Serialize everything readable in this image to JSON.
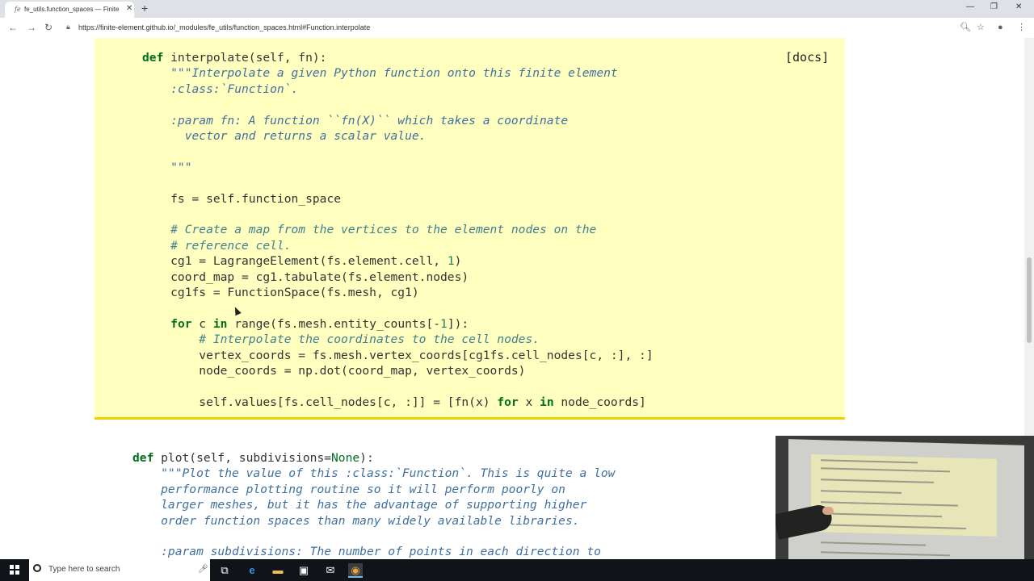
{
  "browser": {
    "tab_title": "fe_utils.function_spaces — Finite",
    "tab_favicon": "fe",
    "tab_close": "✕",
    "new_tab": "+",
    "url": "https://finite-element.github.io/_modules/fe_utils/function_spaces.html#Function.interpolate",
    "window_controls": {
      "minimize": "—",
      "restore": "❐",
      "close": "✕"
    },
    "icons": {
      "back": "arrow-left-icon",
      "forward": "arrow-right-icon",
      "reload": "reload-icon",
      "lock": "lock-icon",
      "zoom": "zoom-icon",
      "star": "star-icon",
      "profile": "profile-icon",
      "menu": "menu-icon"
    }
  },
  "page": {
    "docs_link": "[docs]",
    "code_lines": [
      {
        "t": "def interpolate(self, fn):"
      },
      {
        "t": "    \"\"\"Interpolate a given Python function onto this finite element"
      },
      {
        "t": "    :class:`Function`."
      },
      {
        "t": ""
      },
      {
        "t": "    :param fn: A function ``fn(X)`` which takes a coordinate"
      },
      {
        "t": "      vector and returns a scalar value."
      },
      {
        "t": ""
      },
      {
        "t": "    \"\"\""
      },
      {
        "t": ""
      },
      {
        "t": "    fs = self.function_space"
      },
      {
        "t": ""
      },
      {
        "t": "    # Create a map from the vertices to the element nodes on the"
      },
      {
        "t": "    # reference cell."
      },
      {
        "t": "    cg1 = LagrangeElement(fs.element.cell, 1)"
      },
      {
        "t": "    coord_map = cg1.tabulate(fs.element.nodes)"
      },
      {
        "t": "    cg1fs = FunctionSpace(fs.mesh, cg1)"
      },
      {
        "t": ""
      },
      {
        "t": "    for c in range(fs.mesh.entity_counts[-1]):"
      },
      {
        "t": "        # Interpolate the coordinates to the cell nodes."
      },
      {
        "t": "        vertex_coords = fs.mesh.vertex_coords[cg1fs.cell_nodes[c, :], :]"
      },
      {
        "t": "        node_coords = np.dot(coord_map, vertex_coords)"
      },
      {
        "t": ""
      },
      {
        "t": "        self.values[fs.cell_nodes[c, :]] = [fn(x) for x in node_coords]"
      }
    ],
    "code_lines_2": [
      {
        "t": "def plot(self, subdivisions=None):"
      },
      {
        "t": "    \"\"\"Plot the value of this :class:`Function`. This is quite a low"
      },
      {
        "t": "    performance plotting routine so it will perform poorly on"
      },
      {
        "t": "    larger meshes, but it has the advantage of supporting higher"
      },
      {
        "t": "    order function spaces than many widely available libraries."
      },
      {
        "t": ""
      },
      {
        "t": "    :param subdivisions: The number of points in each direction to"
      }
    ]
  },
  "taskbar": {
    "search_placeholder": "Type here to search",
    "apps": [
      "task-view-icon",
      "edge-browser-icon",
      "file-explorer-icon",
      "store-icon",
      "mail-icon",
      "chrome-icon"
    ]
  }
}
